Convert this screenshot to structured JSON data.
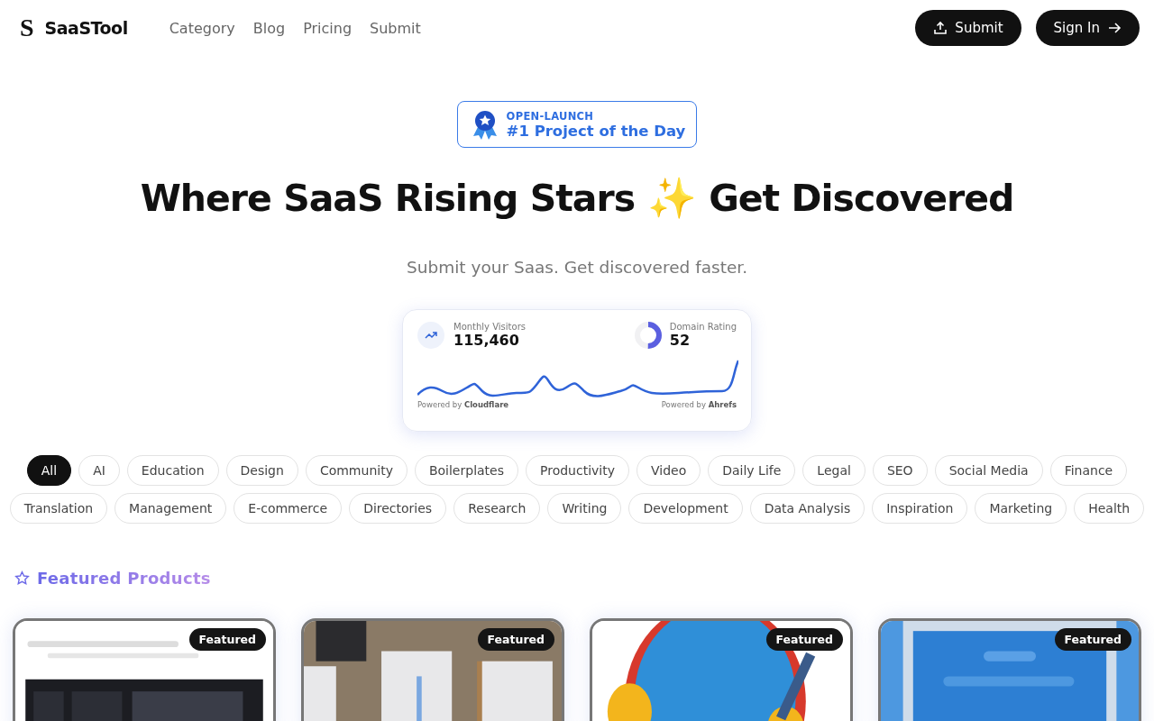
{
  "header": {
    "logo_mark": "S",
    "brand": "SaaSTool",
    "nav": [
      {
        "label": "Category"
      },
      {
        "label": "Blog"
      },
      {
        "label": "Pricing"
      },
      {
        "label": "Submit"
      }
    ],
    "buttons": [
      {
        "label": "Submit",
        "kind": "upload"
      },
      {
        "label": "Sign In",
        "kind": "arrow"
      }
    ]
  },
  "badge": {
    "top": "OPEN-LAUNCH",
    "main": "#1 Project of the Day"
  },
  "hero": {
    "title_start": "Where SaaS Rising Stars",
    "emoji": "✨",
    "title_end": "Get Discovered",
    "subtitle": "Submit your Saas. Get discovered faster."
  },
  "stats": {
    "visitors_label": "Monthly Visitors",
    "visitors": "115,460",
    "rating_label": "Domain Rating",
    "rating": "52",
    "left_footer": "Powered by **Cloudflare**",
    "right_footer": "Powered by **Ahrefs**"
  },
  "categories": [
    {
      "label": "All",
      "selected": true
    },
    {
      "label": "AI",
      "selected": false
    },
    {
      "label": "Education",
      "selected": false
    },
    {
      "label": "Design",
      "selected": false
    },
    {
      "label": "Community",
      "selected": false
    },
    {
      "label": "Boilerplates",
      "selected": false
    },
    {
      "label": "Productivity",
      "selected": false
    },
    {
      "label": "Video",
      "selected": false
    },
    {
      "label": "Daily Life",
      "selected": false
    },
    {
      "label": "Legal",
      "selected": false
    },
    {
      "label": "SEO",
      "selected": false
    },
    {
      "label": "Social Media",
      "selected": false
    },
    {
      "label": "Finance",
      "selected": false
    },
    {
      "label": "Translation",
      "selected": false
    },
    {
      "label": "Management",
      "selected": false
    },
    {
      "label": "E-commerce",
      "selected": false
    },
    {
      "label": "Directories",
      "selected": false
    },
    {
      "label": "Research",
      "selected": false
    },
    {
      "label": "Writing",
      "selected": false
    },
    {
      "label": "Development",
      "selected": false
    },
    {
      "label": "Data Analysis",
      "selected": false
    },
    {
      "label": "Inspiration",
      "selected": false
    },
    {
      "label": "Marketing",
      "selected": false
    },
    {
      "label": "Health",
      "selected": false
    }
  ],
  "featured": {
    "title": "Featured Products",
    "cards": [
      {
        "badge": "Featured",
        "kind": "picture"
      },
      {
        "badge": "Featured",
        "kind": "picture"
      },
      {
        "badge": "Featured",
        "kind": "picture"
      },
      {
        "badge": "Featured",
        "kind": "picture"
      }
    ]
  }
}
